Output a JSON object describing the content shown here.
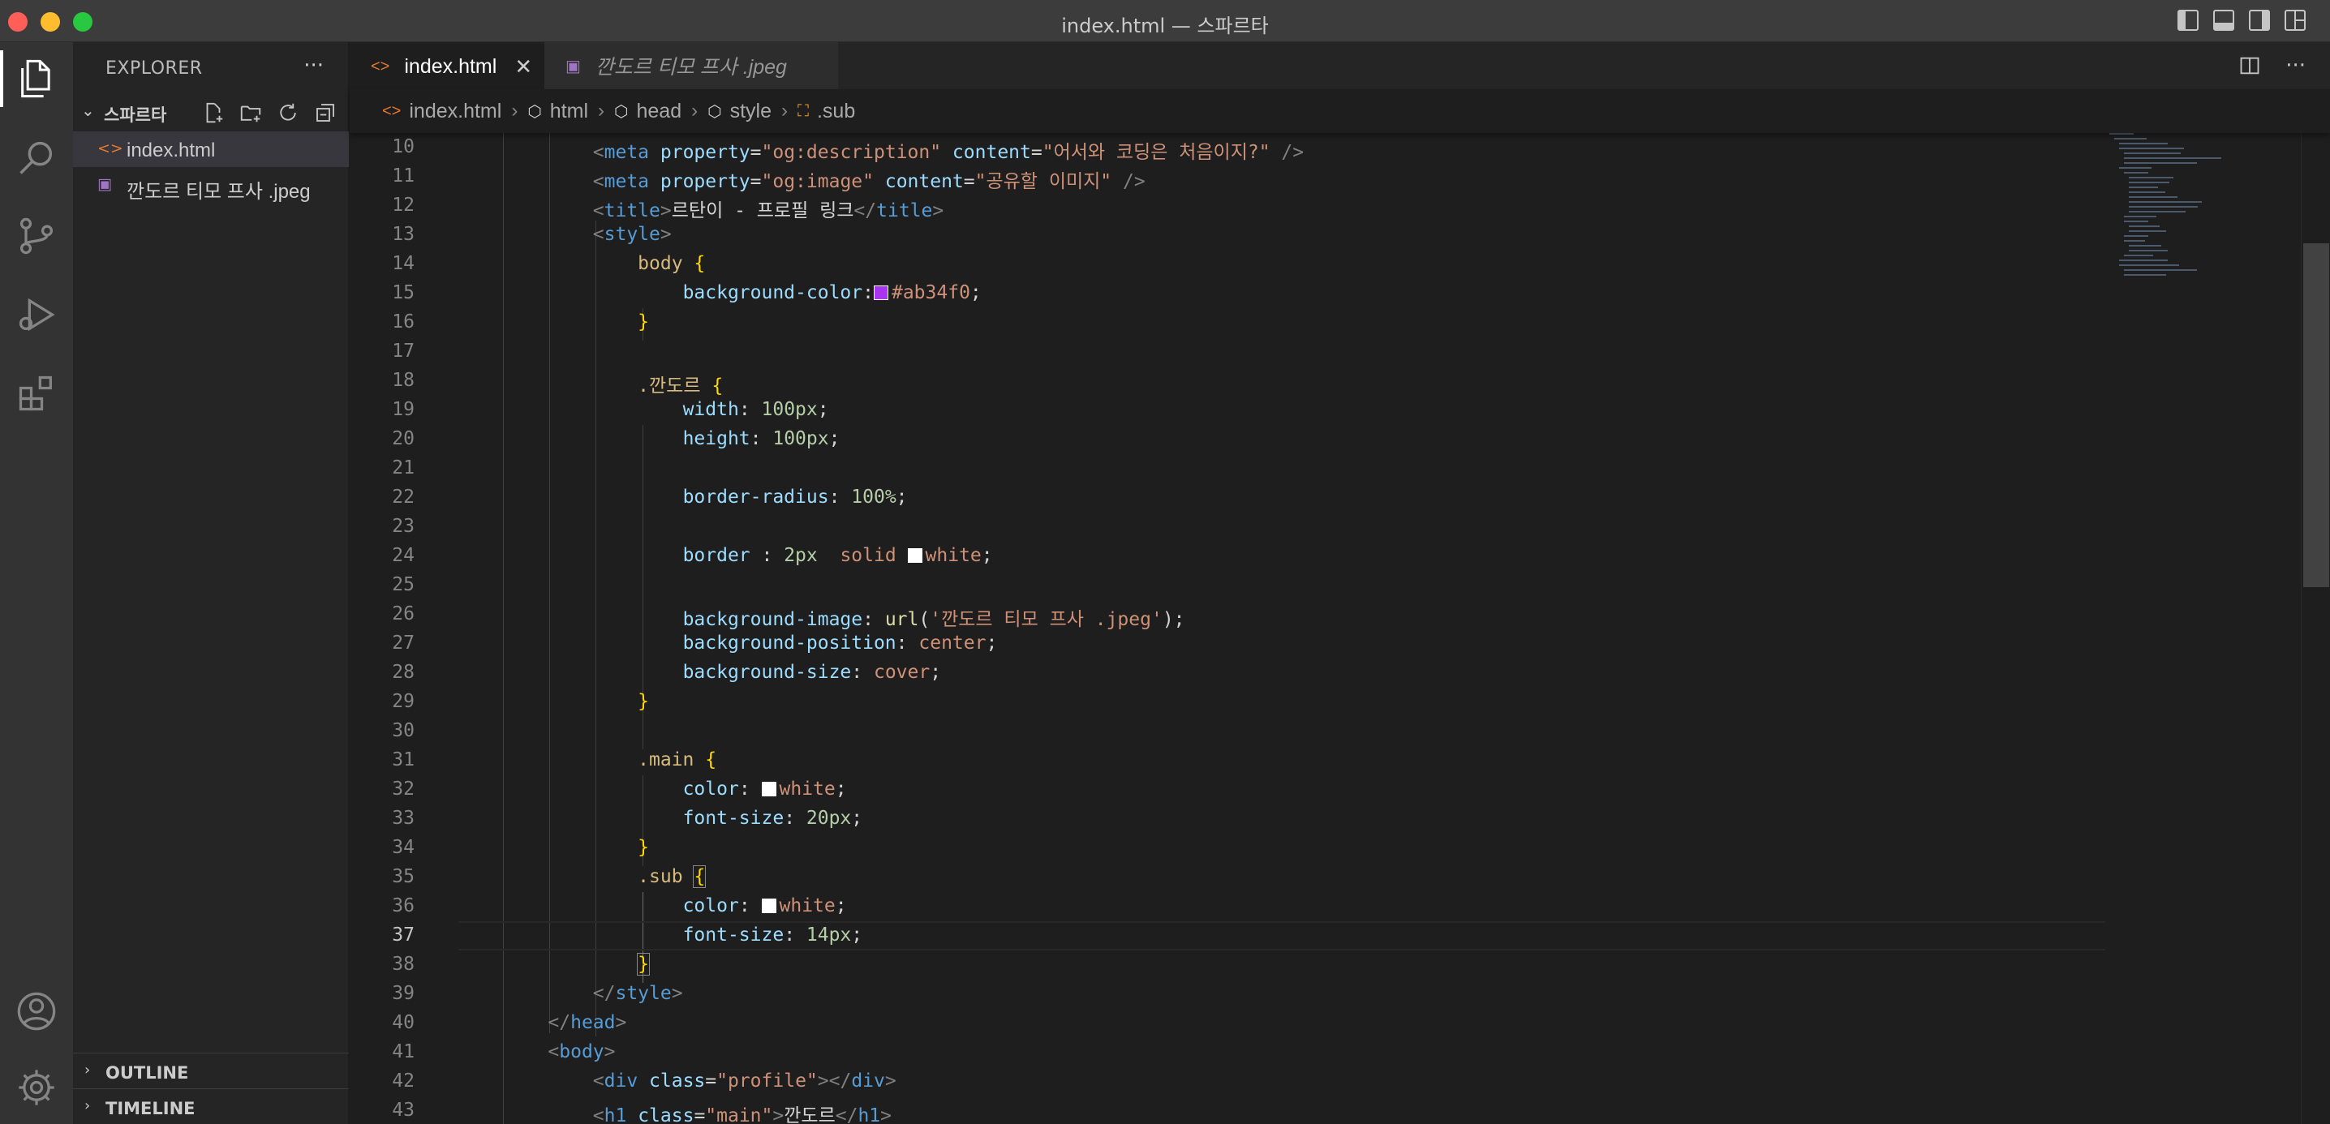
{
  "window": {
    "title": "index.html — 스파르타"
  },
  "activity_bar": {
    "items": [
      "explorer-icon",
      "search-icon",
      "source-control-icon",
      "run-debug-icon",
      "extensions-icon"
    ],
    "bottom": [
      "account-icon",
      "settings-gear-icon"
    ]
  },
  "sidebar": {
    "title": "EXPLORER",
    "more": "···",
    "folder": {
      "name": "스파르타"
    },
    "files": [
      {
        "name": "index.html",
        "type": "html",
        "selected": true
      },
      {
        "name": "깐도르 티모 프사 .jpeg",
        "type": "image",
        "selected": false
      }
    ],
    "panels": {
      "outline": "OUTLINE",
      "timeline": "TIMELINE"
    }
  },
  "tabs": [
    {
      "label": "index.html",
      "active": true
    },
    {
      "label": "깐도르 티모 프사 .jpeg",
      "active": false
    }
  ],
  "editor_actions": {
    "more": "···"
  },
  "breadcrumbs": [
    "index.html",
    "html",
    "head",
    "style",
    ".sub"
  ],
  "editor": {
    "current_line": 37,
    "lines": [
      {
        "n": "10",
        "tokens": [
          [
            "        ",
            ""
          ],
          [
            "<",
            "t-br"
          ],
          [
            "meta",
            "t-tag"
          ],
          [
            " property",
            "t-attr"
          ],
          [
            "=",
            "t-txt"
          ],
          [
            "\"og:description\"",
            "t-str"
          ],
          [
            " content",
            "t-attr"
          ],
          [
            "=",
            "t-txt"
          ],
          [
            "\"어서와 코딩은 처음이지?\"",
            "t-str"
          ],
          [
            " />",
            "t-br"
          ]
        ]
      },
      {
        "n": "11",
        "tokens": [
          [
            "        ",
            ""
          ],
          [
            "<",
            "t-br"
          ],
          [
            "meta",
            "t-tag"
          ],
          [
            " property",
            "t-attr"
          ],
          [
            "=",
            "t-txt"
          ],
          [
            "\"og:image\"",
            "t-str"
          ],
          [
            " content",
            "t-attr"
          ],
          [
            "=",
            "t-txt"
          ],
          [
            "\"공유할 이미지\"",
            "t-str"
          ],
          [
            " />",
            "t-br"
          ]
        ]
      },
      {
        "n": "12",
        "tokens": [
          [
            "        ",
            ""
          ],
          [
            "<",
            "t-br"
          ],
          [
            "title",
            "t-tag"
          ],
          [
            ">",
            "t-br"
          ],
          [
            "르탄이 - 프로필 링크",
            "t-txt"
          ],
          [
            "</",
            "t-br"
          ],
          [
            "title",
            "t-tag"
          ],
          [
            ">",
            "t-br"
          ]
        ]
      },
      {
        "n": "13",
        "tokens": [
          [
            "        ",
            ""
          ],
          [
            "<",
            "t-br"
          ],
          [
            "style",
            "t-tag"
          ],
          [
            ">",
            "t-br"
          ]
        ]
      },
      {
        "n": "14",
        "tokens": [
          [
            "            ",
            ""
          ],
          [
            "body",
            "t-sel"
          ],
          [
            " {",
            "t-brace"
          ]
        ]
      },
      {
        "n": "15",
        "tokens": [
          [
            "                ",
            ""
          ],
          [
            "background-color",
            "t-prop"
          ],
          [
            ":",
            "t-txt"
          ],
          [
            "#ab34f0",
            "swatch"
          ],
          [
            "#ab34f0",
            "t-val"
          ],
          [
            ";",
            "t-txt"
          ]
        ]
      },
      {
        "n": "16",
        "tokens": [
          [
            "            ",
            ""
          ],
          [
            "}",
            "t-brace"
          ]
        ]
      },
      {
        "n": "17",
        "tokens": []
      },
      {
        "n": "18",
        "tokens": [
          [
            "            ",
            ""
          ],
          [
            ".깐도르",
            "t-sel"
          ],
          [
            " {",
            "t-brace"
          ]
        ]
      },
      {
        "n": "19",
        "tokens": [
          [
            "                ",
            ""
          ],
          [
            "width",
            "t-prop"
          ],
          [
            ": ",
            "t-txt"
          ],
          [
            "100px",
            "t-num"
          ],
          [
            ";",
            "t-txt"
          ]
        ]
      },
      {
        "n": "20",
        "tokens": [
          [
            "                ",
            ""
          ],
          [
            "height",
            "t-prop"
          ],
          [
            ": ",
            "t-txt"
          ],
          [
            "100px",
            "t-num"
          ],
          [
            ";",
            "t-txt"
          ]
        ]
      },
      {
        "n": "21",
        "tokens": []
      },
      {
        "n": "22",
        "tokens": [
          [
            "                ",
            ""
          ],
          [
            "border-radius",
            "t-prop"
          ],
          [
            ": ",
            "t-txt"
          ],
          [
            "100%",
            "t-num"
          ],
          [
            ";",
            "t-txt"
          ]
        ]
      },
      {
        "n": "23",
        "tokens": []
      },
      {
        "n": "24",
        "tokens": [
          [
            "                ",
            ""
          ],
          [
            "border",
            "t-prop"
          ],
          [
            " : ",
            "t-txt"
          ],
          [
            "2px",
            "t-num"
          ],
          [
            "  solid ",
            "t-val"
          ],
          [
            "#ffffff",
            "swatch"
          ],
          [
            "white",
            "t-val"
          ],
          [
            ";",
            "t-txt"
          ]
        ]
      },
      {
        "n": "25",
        "tokens": []
      },
      {
        "n": "26",
        "tokens": [
          [
            "                ",
            ""
          ],
          [
            "background-image",
            "t-prop"
          ],
          [
            ": ",
            "t-txt"
          ],
          [
            "url",
            "t-fn"
          ],
          [
            "(",
            "t-txt"
          ],
          [
            "'깐도르 티모 프사 .jpeg'",
            "t-str"
          ],
          [
            ");",
            "t-txt"
          ]
        ]
      },
      {
        "n": "27",
        "tokens": [
          [
            "                ",
            ""
          ],
          [
            "background-position",
            "t-prop"
          ],
          [
            ": ",
            "t-txt"
          ],
          [
            "center",
            "t-val"
          ],
          [
            ";",
            "t-txt"
          ]
        ]
      },
      {
        "n": "28",
        "tokens": [
          [
            "                ",
            ""
          ],
          [
            "background-size",
            "t-prop"
          ],
          [
            ": ",
            "t-txt"
          ],
          [
            "cover",
            "t-val"
          ],
          [
            ";",
            "t-txt"
          ]
        ]
      },
      {
        "n": "29",
        "tokens": [
          [
            "            ",
            ""
          ],
          [
            "}",
            "t-brace"
          ]
        ]
      },
      {
        "n": "30",
        "tokens": []
      },
      {
        "n": "31",
        "tokens": [
          [
            "            ",
            ""
          ],
          [
            ".main",
            "t-sel"
          ],
          [
            " {",
            "t-brace"
          ]
        ]
      },
      {
        "n": "32",
        "tokens": [
          [
            "                ",
            ""
          ],
          [
            "color",
            "t-prop"
          ],
          [
            ": ",
            "t-txt"
          ],
          [
            "#ffffff",
            "swatch"
          ],
          [
            "white",
            "t-val"
          ],
          [
            ";",
            "t-txt"
          ]
        ]
      },
      {
        "n": "33",
        "tokens": [
          [
            "                ",
            ""
          ],
          [
            "font-size",
            "t-prop"
          ],
          [
            ": ",
            "t-txt"
          ],
          [
            "20px",
            "t-num"
          ],
          [
            ";",
            "t-txt"
          ]
        ]
      },
      {
        "n": "34",
        "tokens": [
          [
            "            ",
            ""
          ],
          [
            "}",
            "t-brace"
          ]
        ]
      },
      {
        "n": "35",
        "tokens": [
          [
            "            ",
            ""
          ],
          [
            ".sub",
            "t-sel"
          ],
          [
            " ",
            "t-txt"
          ],
          [
            "{",
            "t-brace match"
          ]
        ]
      },
      {
        "n": "36",
        "tokens": [
          [
            "                ",
            ""
          ],
          [
            "color",
            "t-prop"
          ],
          [
            ": ",
            "t-txt"
          ],
          [
            "#ffffff",
            "swatch"
          ],
          [
            "white",
            "t-val"
          ],
          [
            ";",
            "t-txt"
          ]
        ]
      },
      {
        "n": "37",
        "tokens": [
          [
            "                ",
            ""
          ],
          [
            "font-size",
            "t-prop"
          ],
          [
            ": ",
            "t-txt"
          ],
          [
            "14px",
            "t-num"
          ],
          [
            ";",
            "t-txt"
          ]
        ]
      },
      {
        "n": "38",
        "tokens": [
          [
            "            ",
            ""
          ],
          [
            "}",
            "t-brace match"
          ]
        ]
      },
      {
        "n": "39",
        "tokens": [
          [
            "        ",
            ""
          ],
          [
            "</",
            "t-br"
          ],
          [
            "style",
            "t-tag"
          ],
          [
            ">",
            "t-br"
          ]
        ]
      },
      {
        "n": "40",
        "tokens": [
          [
            "    ",
            ""
          ],
          [
            "</",
            "t-br"
          ],
          [
            "head",
            "t-tag"
          ],
          [
            ">",
            "t-br"
          ]
        ]
      },
      {
        "n": "41",
        "tokens": [
          [
            "    ",
            ""
          ],
          [
            "<",
            "t-br"
          ],
          [
            "body",
            "t-tag"
          ],
          [
            ">",
            "t-br"
          ]
        ]
      },
      {
        "n": "42",
        "tokens": [
          [
            "        ",
            ""
          ],
          [
            "<",
            "t-br"
          ],
          [
            "div",
            "t-tag"
          ],
          [
            " class",
            "t-attr"
          ],
          [
            "=",
            "t-txt"
          ],
          [
            "\"profile\"",
            "t-str"
          ],
          [
            "></",
            "t-br"
          ],
          [
            "div",
            "t-tag"
          ],
          [
            ">",
            "t-br"
          ]
        ]
      },
      {
        "n": "43",
        "tokens": [
          [
            "        ",
            ""
          ],
          [
            "<",
            "t-br"
          ],
          [
            "h1",
            "t-tag"
          ],
          [
            " class",
            "t-attr"
          ],
          [
            "=",
            "t-txt"
          ],
          [
            "\"main\"",
            "t-str"
          ],
          [
            ">",
            "t-br"
          ],
          [
            "깐도르",
            "t-txt"
          ],
          [
            "</",
            "t-br"
          ],
          [
            "h1",
            "t-tag"
          ],
          [
            ">",
            "t-br"
          ]
        ]
      }
    ]
  },
  "colors": {
    "accent": "#007acc",
    "swatch_purple": "#ab34f0",
    "html_icon": "#e37933",
    "image_icon": "#a074c4"
  }
}
